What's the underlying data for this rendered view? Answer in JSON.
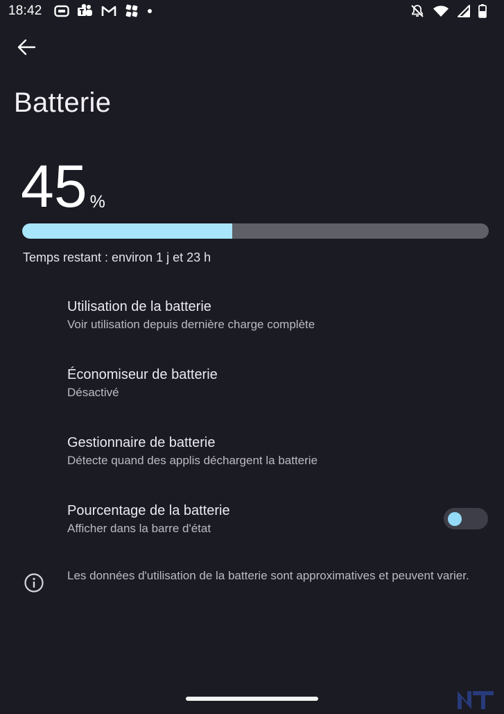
{
  "status_bar": {
    "time": "18:42",
    "left_icons": [
      "screen-record-icon",
      "teams-icon",
      "gmail-icon",
      "pinwheel-icon",
      "dot-icon"
    ],
    "right_icons": [
      "notifications-off-icon",
      "wifi-icon",
      "cell-signal-icon",
      "battery-icon"
    ]
  },
  "header": {
    "back_icon": "arrow-back-icon",
    "title": "Batterie"
  },
  "battery": {
    "level": "45",
    "unit": "%",
    "level_fraction": 0.45,
    "remaining": "Temps restant : environ 1 j et 23 h",
    "fill_color": "#a8e6fb",
    "track_color": "#5f5f67"
  },
  "settings": [
    {
      "title": "Utilisation de la batterie",
      "summary": "Voir utilisation depuis dernière charge complète"
    },
    {
      "title": "Économiseur de batterie",
      "summary": "Désactivé"
    },
    {
      "title": "Gestionnaire de batterie",
      "summary": "Détecte quand des applis déchargent la batterie"
    },
    {
      "title": "Pourcentage de la batterie",
      "summary": "Afficher dans la barre d'état",
      "toggle_on": false
    }
  ],
  "info": {
    "icon": "info-icon",
    "text": "Les données d'utilisation de la batterie sont approximatives et peuvent varier."
  },
  "colors": {
    "background": "#1a1b23",
    "accent": "#94dbf8"
  }
}
